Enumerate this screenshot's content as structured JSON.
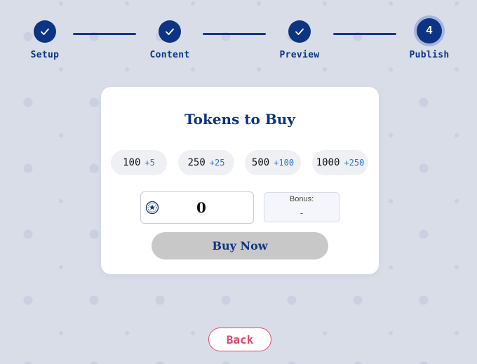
{
  "stepper": {
    "steps": [
      {
        "label": "Setup",
        "state": "complete",
        "icon": "check-icon"
      },
      {
        "label": "Content",
        "state": "complete",
        "icon": "check-icon"
      },
      {
        "label": "Preview",
        "state": "complete",
        "icon": "check-icon"
      },
      {
        "label": "Publish",
        "state": "active",
        "number": "4"
      }
    ]
  },
  "card": {
    "title": "Tokens to Buy",
    "packages": [
      {
        "amount": "100",
        "bonus": "+5"
      },
      {
        "amount": "250",
        "bonus": "+25"
      },
      {
        "amount": "500",
        "bonus": "+100"
      },
      {
        "amount": "1000",
        "bonus": "+250"
      }
    ],
    "amount": {
      "value": "0",
      "icon": "token-coin-icon"
    },
    "bonus": {
      "label": "Bonus:",
      "value": "-"
    },
    "buy_label": "Buy Now"
  },
  "back_label": "Back",
  "colors": {
    "primary": "#0d3482",
    "accent_blue": "#2a73c9",
    "danger": "#e2476c",
    "background": "#d9dde8",
    "button_disabled": "#c8c8c8"
  }
}
